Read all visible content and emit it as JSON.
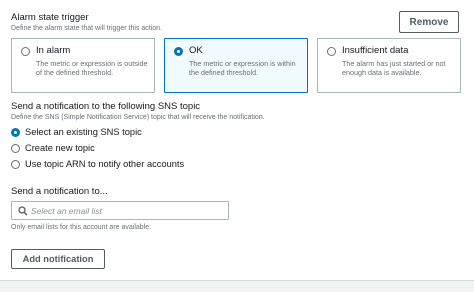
{
  "alarm": {
    "title": "Alarm state trigger",
    "description": "Define the alarm state that will trigger this action.",
    "remove_label": "Remove",
    "options": [
      {
        "label": "In alarm",
        "description": "The metric or expression is outside of the defined threshold.",
        "selected": false
      },
      {
        "label": "OK",
        "description": "The metric or expression is within the defined threshold.",
        "selected": true
      },
      {
        "label": "Insufficient data",
        "description": "The alarm has just started or not enough data is available.",
        "selected": false
      }
    ]
  },
  "sns": {
    "title": "Send a notification to the following SNS topic",
    "description": "Define the SNS (Simple Notification Service) topic that will receive the notification.",
    "options": [
      {
        "label": "Select an existing SNS topic",
        "selected": true
      },
      {
        "label": "Create new topic",
        "selected": false
      },
      {
        "label": "Use topic ARN to notify other accounts",
        "selected": false
      }
    ]
  },
  "notify": {
    "title": "Send a notification to...",
    "placeholder": "Select an email list",
    "hint": "Only email lists for this account are available.",
    "add_label": "Add notification"
  },
  "colors": {
    "accent": "#0073bb",
    "selected_bg": "#f1faff",
    "border": "#aab7b8",
    "muted_text": "#687078"
  }
}
